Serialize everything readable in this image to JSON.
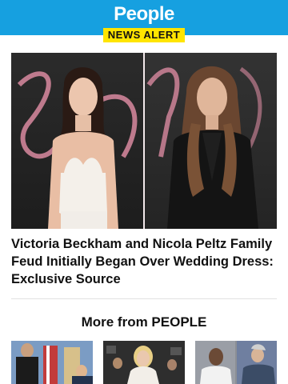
{
  "brand": {
    "logo_text": "People",
    "tag": "NEWS ALERT"
  },
  "article": {
    "headline": "Victoria Beckham and Nicola Peltz Family Feud Initially Began Over Wedding Dress: Exclusive Source"
  },
  "more": {
    "heading": "More from PEOPLE"
  },
  "colors": {
    "brand_blue": "#16a0e0",
    "alert_yellow": "#ffe500"
  }
}
